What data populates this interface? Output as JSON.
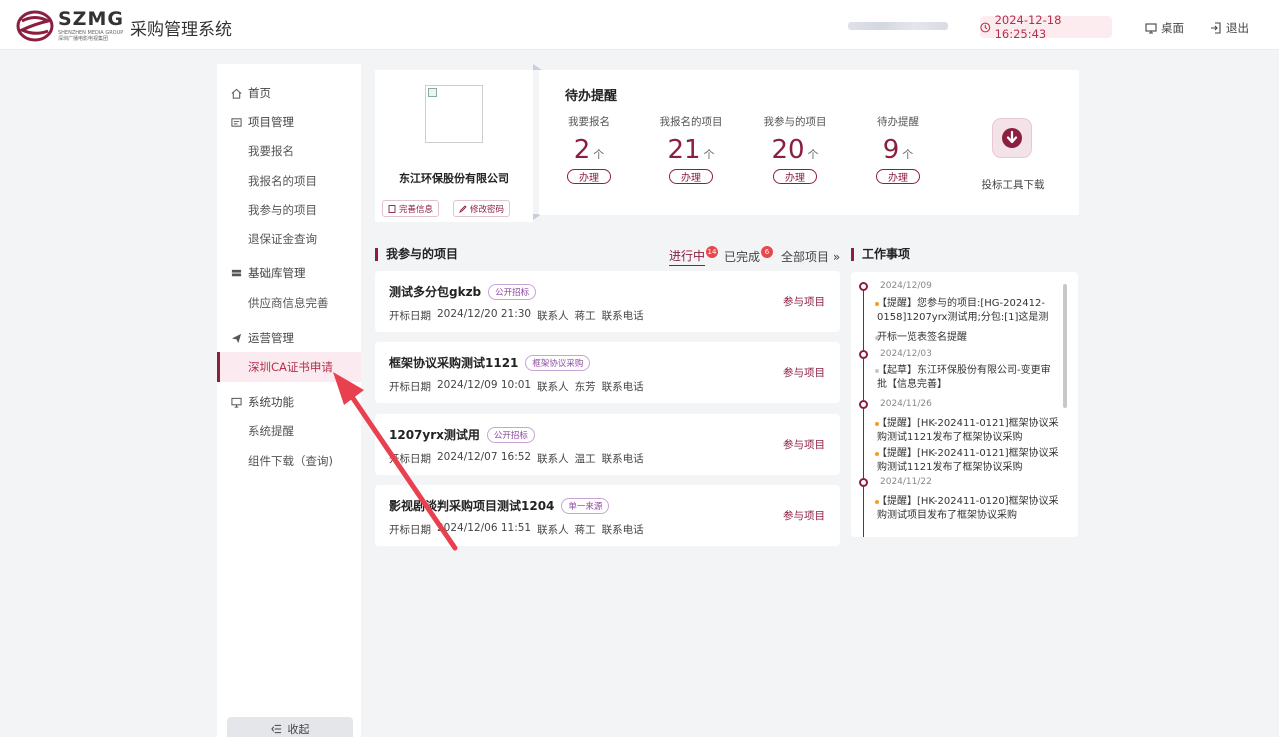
{
  "header": {
    "logo_big": "SZMG",
    "logo_small_en": "SHENZHEN MEDIA GROUP",
    "logo_small_cn": "深圳广播电影电视集团",
    "system_title": "采购管理系统",
    "datetime": "2024-12-18 16:25:43",
    "desktop_label": "桌面",
    "logout_label": "退出"
  },
  "sidebar": {
    "home": "首页",
    "project_mgmt": "项目管理",
    "items_project": [
      "我要报名",
      "我报名的项目",
      "我参与的项目",
      "退保证金查询"
    ],
    "basic_mgmt": "基础库管理",
    "items_basic": [
      "供应商信息完善"
    ],
    "ops_mgmt": "运营管理",
    "items_ops": [
      "深圳CA证书申请"
    ],
    "sys_func": "系统功能",
    "items_sys": [
      "系统提醒",
      "组件下载（查询)"
    ],
    "collapse_label": "收起"
  },
  "company": {
    "name": "东江环保股份有限公司",
    "btn_info": "完善信息",
    "btn_pwd": "修改密码"
  },
  "todo": {
    "title": "待办提醒",
    "unit": "个",
    "action": "办理",
    "cols": [
      {
        "label": "我要报名",
        "count": "2"
      },
      {
        "label": "我报名的项目",
        "count": "21"
      },
      {
        "label": "我参与的项目",
        "count": "20"
      },
      {
        "label": "待办提醒",
        "count": "9"
      }
    ],
    "download_label": "投标工具下载"
  },
  "projects_section": {
    "title": "我参与的项目",
    "filter_active": "进行中",
    "filter_active_count": "14",
    "filter_done": "已完成",
    "filter_done_count": "6",
    "filter_all": "全部项目 »"
  },
  "projects": [
    {
      "name": "测试多分包gkzb",
      "tag": "公开招标",
      "meta_label": "开标日期",
      "date": "2024/12/20 21:30",
      "contact_label": "联系人",
      "contact": "蒋工",
      "phone_label": "联系电话",
      "action": "参与项目"
    },
    {
      "name": "框架协议采购测试1121",
      "tag": "框架协议采购",
      "meta_label": "开标日期",
      "date": "2024/12/09 10:01",
      "contact_label": "联系人",
      "contact": "东芳",
      "phone_label": "联系电话",
      "action": "参与项目"
    },
    {
      "name": "1207yrx测试用",
      "tag": "公开招标",
      "meta_label": "开标日期",
      "date": "2024/12/07 16:52",
      "contact_label": "联系人",
      "contact": "温工",
      "phone_label": "联系电话",
      "action": "参与项目"
    },
    {
      "name": "影视剧谈判采购项目测试1204",
      "tag": "单一来源",
      "meta_label": "开标日期",
      "date": "2024/12/06 11:51",
      "contact_label": "联系人",
      "contact": "蒋工",
      "phone_label": "联系电话",
      "action": "参与项目"
    }
  ],
  "work_section": {
    "title": "工作事项",
    "entries": [
      {
        "date": "2024/12/09",
        "items": [
          {
            "text": "【提醒】您参与的项目:[HG-202412-0158]1207yrx测试用;分包:[1]这是测",
            "color": "orange"
          },
          {
            "text": "开标一览表签名提醒",
            "color": "gray"
          }
        ]
      },
      {
        "date": "2024/12/03",
        "items": [
          {
            "text": "【起草】东江环保股份有限公司-变更审批【信息完善】",
            "color": "gray"
          }
        ]
      },
      {
        "date": "2024/11/26",
        "items": [
          {
            "text": "【提醒】[HK-202411-0121]框架协议采购测试1121发布了框架协议采购",
            "color": "orange"
          },
          {
            "text": "【提醒】[HK-202411-0121]框架协议采购测试1121发布了框架协议采购",
            "color": "orange"
          }
        ]
      },
      {
        "date": "2024/11/22",
        "items": [
          {
            "text": "【提醒】[HK-202411-0120]框架协议采购测试项目发布了框架协议采购",
            "color": "orange"
          }
        ]
      }
    ]
  },
  "colors": {
    "accent": "#8c1f3f",
    "badge": "#e5484d",
    "arrow": "#e8404f"
  }
}
